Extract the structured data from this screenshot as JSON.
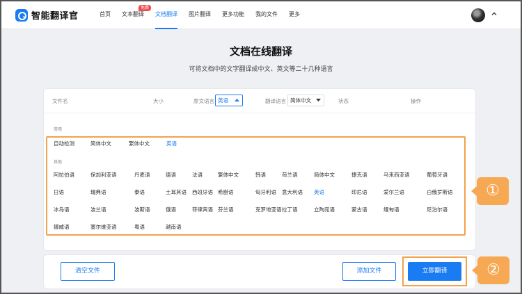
{
  "app": {
    "name": "智能翻译官"
  },
  "nav": [
    {
      "label": "首页",
      "active": false
    },
    {
      "label": "文本翻译",
      "active": false,
      "badge": "免费"
    },
    {
      "label": "文档翻译",
      "active": true
    },
    {
      "label": "图片翻译",
      "active": false
    },
    {
      "label": "更多功能",
      "active": false
    },
    {
      "label": "我的文件",
      "active": false
    },
    {
      "label": "更多",
      "active": false
    }
  ],
  "page": {
    "title": "文档在线翻译",
    "subtitle": "可将文档中的文字翻译成中文、英文等二十几种语言"
  },
  "table": {
    "col_file": "文件名",
    "col_size": "大小",
    "col_source": "原文语言",
    "source_value": "英语",
    "col_target": "翻译语言",
    "target_value": "简体中文",
    "col_status": "状态",
    "col_action": "操作"
  },
  "languages": {
    "common_label": "常用",
    "common": [
      "自动检测",
      "简体中文",
      "繁体中文",
      "英语"
    ],
    "common_selected": "英语",
    "other_label": "其他",
    "rows": [
      [
        "阿拉伯语",
        "保加利亚语",
        "丹麦语",
        "德语",
        "法语",
        "繁体中文",
        "韩语",
        "荷兰语",
        "简体中文",
        "捷克语",
        "马来西亚语",
        "葡萄牙语"
      ],
      [
        "日语",
        "瑞典语",
        "泰语",
        "土耳其语",
        "西班牙语",
        "希腊语",
        "匈牙利语",
        "意大利语",
        "英语",
        "印尼语",
        "爱尔兰语",
        "白俄罗斯语"
      ],
      [
        "冰岛语",
        "波兰语",
        "波斯语",
        "俄语",
        "菲律宾语",
        "芬兰语",
        "克罗地亚语",
        "拉丁语",
        "立陶宛语",
        "蒙古语",
        "缅甸语",
        "尼泊尔语"
      ],
      [
        "挪威语",
        "塞尔维亚语",
        "粤语",
        "越南语"
      ]
    ],
    "other_selected": "英语"
  },
  "buttons": {
    "clear": "清空文件",
    "add": "添加文件",
    "translate": "立即翻译"
  },
  "markers": {
    "m1": "①",
    "m2": "②"
  },
  "colors": {
    "accent": "#1a7cf2",
    "highlight": "#f3a14a",
    "badge": "#f04848"
  }
}
